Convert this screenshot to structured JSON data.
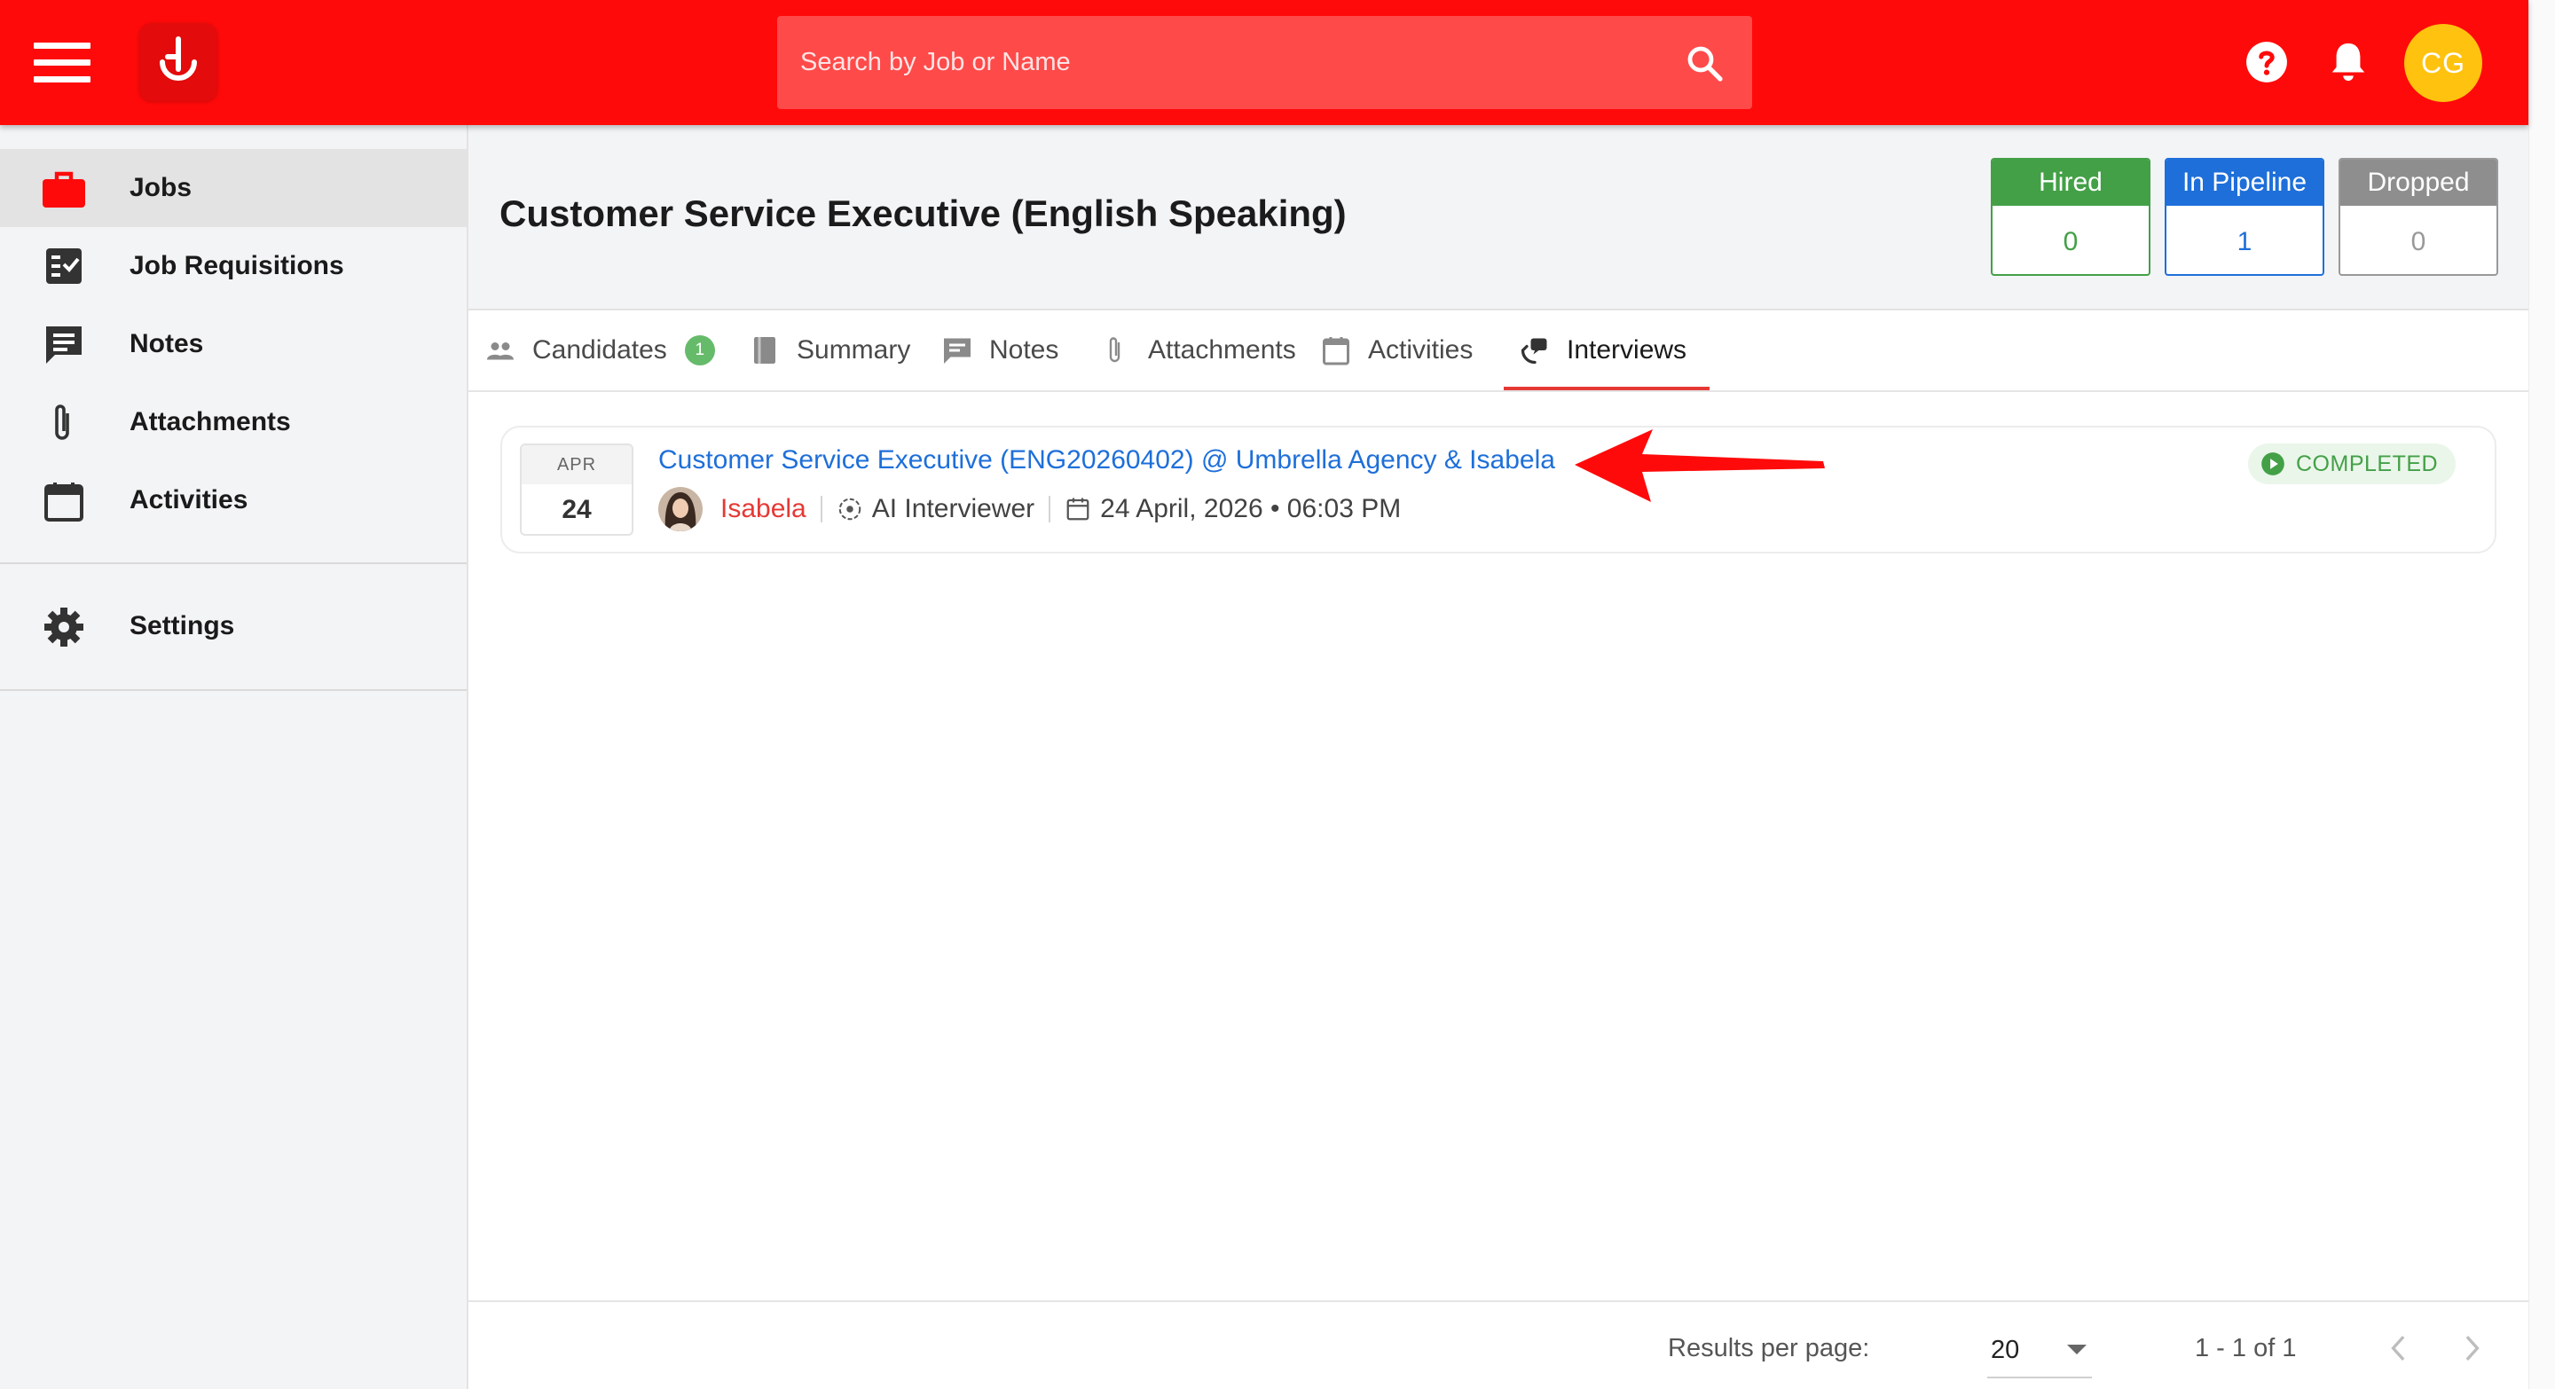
{
  "app": {
    "search_placeholder": "Search by Job or Name",
    "avatar_initials": "CG",
    "brand_color": "#ff0a0a"
  },
  "sidebar": {
    "items": [
      {
        "label": "Jobs",
        "icon": "briefcase-icon",
        "active": true
      },
      {
        "label": "Job Requisitions",
        "icon": "checklist-icon"
      },
      {
        "label": "Notes",
        "icon": "note-icon"
      },
      {
        "label": "Attachments",
        "icon": "paperclip-icon"
      },
      {
        "label": "Activities",
        "icon": "calendar-icon"
      },
      {
        "label": "Settings",
        "icon": "gear-icon"
      }
    ]
  },
  "header": {
    "title": "Customer Service Executive (English Speaking)",
    "stats": {
      "hired_label": "Hired",
      "hired_value": "0",
      "pipeline_label": "In Pipeline",
      "pipeline_value": "1",
      "dropped_label": "Dropped",
      "dropped_value": "0"
    }
  },
  "tabs": [
    {
      "label": "Candidates",
      "badge": "1",
      "icon": "people-icon"
    },
    {
      "label": "Summary",
      "icon": "book-icon"
    },
    {
      "label": "Notes",
      "icon": "note-icon"
    },
    {
      "label": "Attachments",
      "icon": "paperclip-icon"
    },
    {
      "label": "Activities",
      "icon": "calendar-icon"
    },
    {
      "label": "Interviews",
      "icon": "interview-icon",
      "active": true
    }
  ],
  "interview": {
    "month": "APR",
    "day": "24",
    "title": "Customer Service Executive (ENG20260402) @ Umbrella Agency & Isabela",
    "candidate": "Isabela",
    "interviewer": "AI Interviewer",
    "datetime": "24 April, 2026 • 06:03 PM",
    "status": "COMPLETED"
  },
  "footer": {
    "results_per_page_label": "Results per page:",
    "results_per_page_value": "20",
    "range": "1 - 1 of 1"
  }
}
